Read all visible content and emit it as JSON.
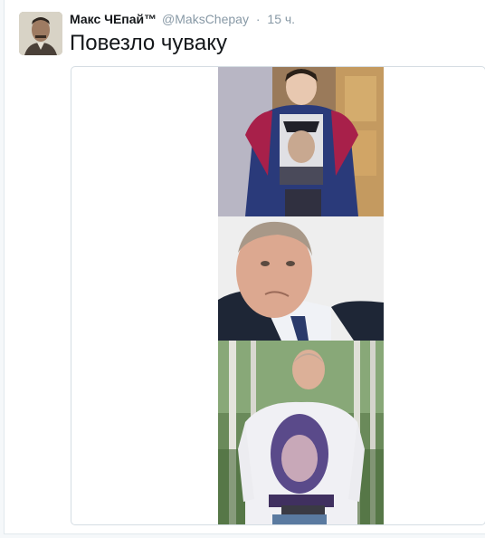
{
  "tweet": {
    "author_name": "Макс ЧЕпай™",
    "author_handle": "@MaksChepay",
    "separator": "·",
    "timestamp": "15 ч.",
    "text": "Повезло чуваку"
  },
  "icons": {
    "avatar": "avatar-photo",
    "media": "photo-collage"
  },
  "colors": {
    "name": "#14171a",
    "meta": "#8899a6",
    "border": "#e1e8ed"
  }
}
